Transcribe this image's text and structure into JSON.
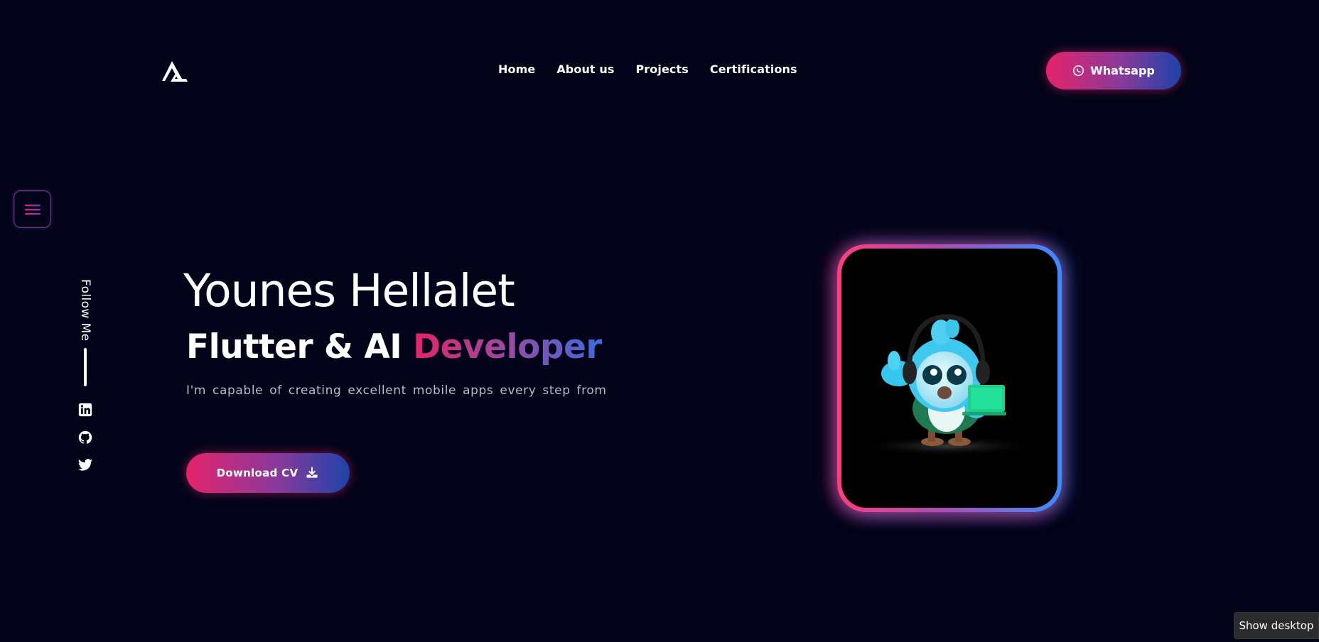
{
  "header": {
    "logo_icon": "triangle-logo-icon",
    "nav": [
      {
        "label": "Home"
      },
      {
        "label": "About us"
      },
      {
        "label": "Projects"
      },
      {
        "label": "Certifications"
      }
    ],
    "whatsapp_label": "Whatsapp",
    "whatsapp_icon": "whatsapp-icon"
  },
  "sidebar": {
    "menu_icon": "hamburger-icon",
    "follow_label": "Follow Me",
    "social": [
      {
        "icon": "linkedin-icon"
      },
      {
        "icon": "github-icon"
      },
      {
        "icon": "twitter-icon"
      }
    ]
  },
  "hero": {
    "name": "Younes Hellalet",
    "role_prefix": "Flutter & AI ",
    "role_accent": "Developer",
    "description": "I'm capable of creating excellent mobile apps every step from",
    "cv_label": "Download CV",
    "cv_icon": "download-icon"
  },
  "taskbar": {
    "tooltip": "Show desktop"
  },
  "colors": {
    "background": "#03041a",
    "accent_pink": "#e5236a",
    "accent_blue": "#1d43a8",
    "glow_blue": "#3a8cff"
  }
}
